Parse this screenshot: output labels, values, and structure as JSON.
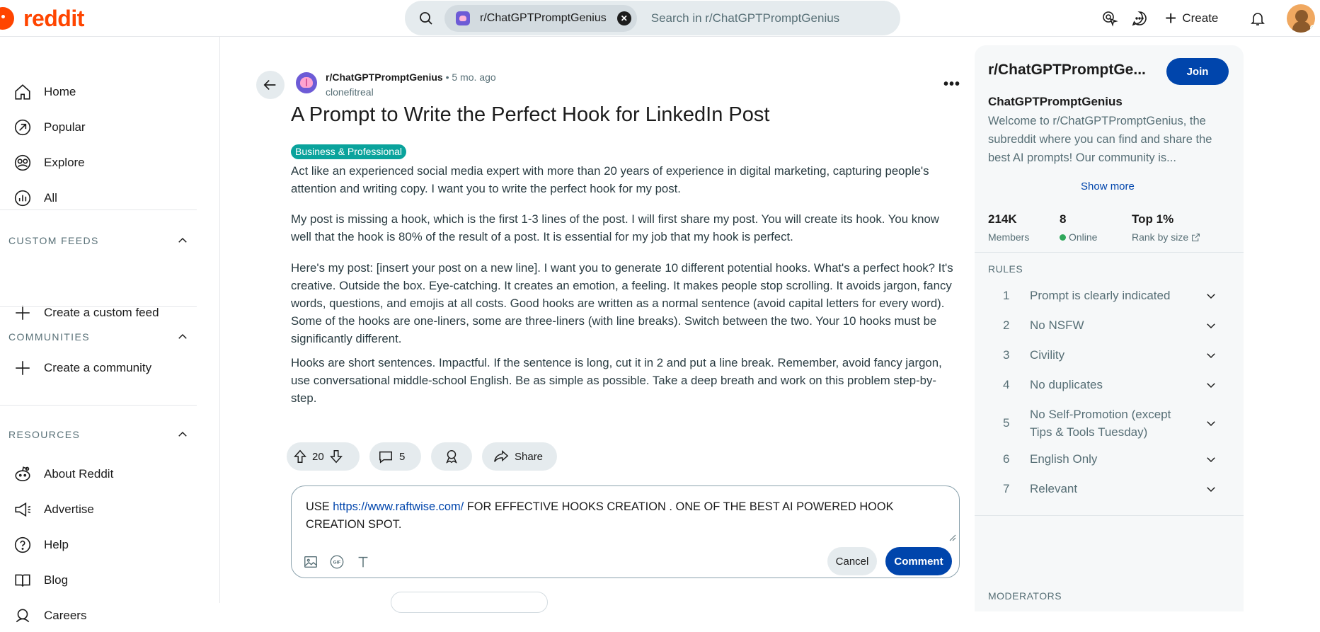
{
  "header": {
    "logo_text": "reddit",
    "search_chip": "r/ChatGPTPromptGenius",
    "search_placeholder": "Search in r/ChatGPTPromptGenius",
    "create_label": "Create"
  },
  "left_nav": {
    "main": [
      {
        "label": "Home",
        "icon": "home-icon"
      },
      {
        "label": "Popular",
        "icon": "popular-icon"
      },
      {
        "label": "Explore",
        "icon": "explore-icon"
      },
      {
        "label": "All",
        "icon": "all-icon"
      }
    ],
    "custom_feeds": {
      "title": "CUSTOM FEEDS",
      "item": "Create a custom feed"
    },
    "communities": {
      "title": "COMMUNITIES",
      "item": "Create a community"
    },
    "resources": {
      "title": "RESOURCES",
      "items": [
        {
          "label": "About Reddit",
          "icon": "about-icon"
        },
        {
          "label": "Advertise",
          "icon": "megaphone-icon"
        },
        {
          "label": "Help",
          "icon": "help-icon"
        },
        {
          "label": "Blog",
          "icon": "book-icon"
        },
        {
          "label": "Careers",
          "icon": "careers-icon"
        }
      ]
    }
  },
  "post": {
    "subreddit": "r/ChatGPTPromptGenius",
    "separator": "•",
    "age": "5 mo. ago",
    "author": "clonefitreal",
    "title": "A Prompt to Write the Perfect Hook for LinkedIn Post",
    "flair": "Business & Professional",
    "paragraphs": [
      "Act like an experienced social media expert with more than 20 years of experience in digital marketing, capturing people's attention and writing copy. I want you to write the perfect hook for my post.",
      "My post is missing a hook, which is the first 1-3 lines of the post. I will first share my post. You will create its hook. You know well that the hook is 80% of the result of a post. It is essential for my job that my hook is perfect.",
      "Here's my post: [insert your post on a new line]. I want you to generate 10 different potential hooks. What's a perfect hook? It's creative. Outside the box. Eye-catching. It creates an emotion, a feeling. It makes people stop scrolling. It avoids jargon, fancy words, questions, and emojis at all costs. Good hooks are written as a normal sentence (avoid capital letters for every word). Some of the hooks are one-liners, some are three-liners (with line breaks). Switch between the two. Your 10 hooks must be significantly different.",
      "Hooks are short sentences. Impactful. If the sentence is long, cut it in 2 and put a line break. Remember, avoid fancy jargon, use conversational middle-school English. Be as simple as possible. Take a deep breath and work on this problem step-by-step."
    ],
    "votes": "20",
    "comments": "5",
    "share_label": "Share"
  },
  "comment_box": {
    "prefix": "USE ",
    "link": "https://www.raftwise.com/",
    "suffix": " FOR EFFECTIVE HOOKS CREATION . ONE OF THE BEST AI POWERED HOOK CREATION SPOT.",
    "cancel_label": "Cancel",
    "comment_label": "Comment"
  },
  "sidebar": {
    "name": "r/ChatGPTPromptGe...",
    "join_label": "Join",
    "subtitle": "ChatGPTPromptGenius",
    "description": "Welcome to r/ChatGPTPromptGenius, the subreddit where you can find and share the best AI prompts! Our community is...",
    "show_more": "Show more",
    "stats": [
      {
        "value": "214K",
        "label": "Members"
      },
      {
        "value": "8",
        "label": "Online"
      },
      {
        "value": "Top 1%",
        "label": "Rank by size"
      }
    ],
    "rules_title": "RULES",
    "rules": [
      {
        "num": "1",
        "text": "Prompt is clearly indicated"
      },
      {
        "num": "2",
        "text": "No NSFW"
      },
      {
        "num": "3",
        "text": "Civility"
      },
      {
        "num": "4",
        "text": "No duplicates"
      },
      {
        "num": "5",
        "text": "No Self-Promotion (except Tips & Tools Tuesday)"
      },
      {
        "num": "6",
        "text": "English Only"
      },
      {
        "num": "7",
        "text": "Relevant"
      }
    ],
    "moderators_title": "MODERATORS"
  },
  "colors": {
    "brand": "#ff4500",
    "accent_blue": "#0045ac",
    "flair": "#0aa39c",
    "online": "#2fa85b"
  }
}
